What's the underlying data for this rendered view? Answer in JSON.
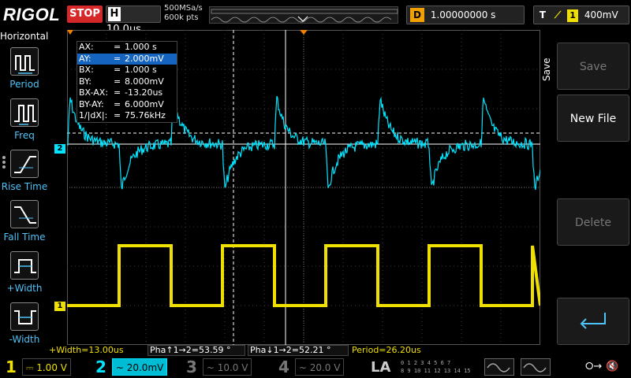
{
  "header": {
    "brand": "RIGOL",
    "run_state": "STOP",
    "horizontal_label": "H",
    "timebase": "10.0us",
    "sample_rate": "500MSa/s",
    "memory_depth": "600k pts",
    "delay_label": "D",
    "delay_value": "1.00000000 s",
    "trigger_label": "T",
    "trigger_edge_icon": "rising-edge-icon",
    "trigger_channel": "1",
    "trigger_level": "400mV"
  },
  "left_menu": {
    "title": "Horizontal",
    "items": [
      {
        "label": "Period",
        "icon": "period-icon"
      },
      {
        "label": "Freq",
        "icon": "frequency-icon"
      },
      {
        "label": "Rise Time",
        "icon": "rise-time-icon"
      },
      {
        "label": "Fall Time",
        "icon": "fall-time-icon"
      },
      {
        "label": "+Width",
        "icon": "positive-width-icon"
      },
      {
        "label": "-Width",
        "icon": "negative-width-icon"
      }
    ]
  },
  "cursor_table": {
    "rows": [
      {
        "label": "AX:",
        "value": "1.000 s",
        "selected": false
      },
      {
        "label": "AY:",
        "value": "2.000mV",
        "selected": true
      },
      {
        "label": "BX:",
        "value": "1.000 s",
        "selected": false
      },
      {
        "label": "BY:",
        "value": "8.000mV",
        "selected": false
      },
      {
        "label": "BX-AX:",
        "value": "-13.20us",
        "selected": false
      },
      {
        "label": "BY-AY:",
        "value": "6.000mV",
        "selected": false
      },
      {
        "label": "1/|dX|:",
        "value": "75.76kHz",
        "selected": false
      }
    ]
  },
  "channel_markers": {
    "ch1": "1",
    "ch2": "2",
    "trigger": "T"
  },
  "right_menu": {
    "side_title": "Save",
    "buttons": [
      {
        "label": "Save",
        "enabled": false
      },
      {
        "label": "New File",
        "enabled": true
      },
      {
        "label": "Delete",
        "enabled": false
      },
      {
        "label": "",
        "icon": "enter-icon",
        "enabled": true
      }
    ]
  },
  "measurements": {
    "pos_width": "+Width=13.00us",
    "phase_rise": "Pha↑1→2=53.59 °",
    "phase_fall": "Pha↓1→2=52.21 °",
    "period": "Period=26.20us"
  },
  "bottom_bar": {
    "channels": [
      {
        "num": "1",
        "scale": "1.00 V",
        "coupling": "⎓",
        "active": true
      },
      {
        "num": "2",
        "scale": "20.0mV",
        "coupling": "~",
        "active": true
      },
      {
        "num": "3",
        "scale": "10.0 V",
        "coupling": "~",
        "active": false
      },
      {
        "num": "4",
        "scale": "20.0 V",
        "coupling": "~",
        "active": false
      }
    ],
    "la_label": "LA",
    "la_bits_top": "0 1 2 3  4 5 6 7",
    "la_bits_bottom": "8 9 10 11 12 13 14 15",
    "usb_icon": "usb-icon",
    "speaker_icon": "speaker-muted-icon"
  },
  "colors": {
    "ch1": "#f0e000",
    "ch2": "#00e5ff",
    "trigger": "#f08000",
    "grid": "#444444",
    "stop": "#d62828"
  }
}
